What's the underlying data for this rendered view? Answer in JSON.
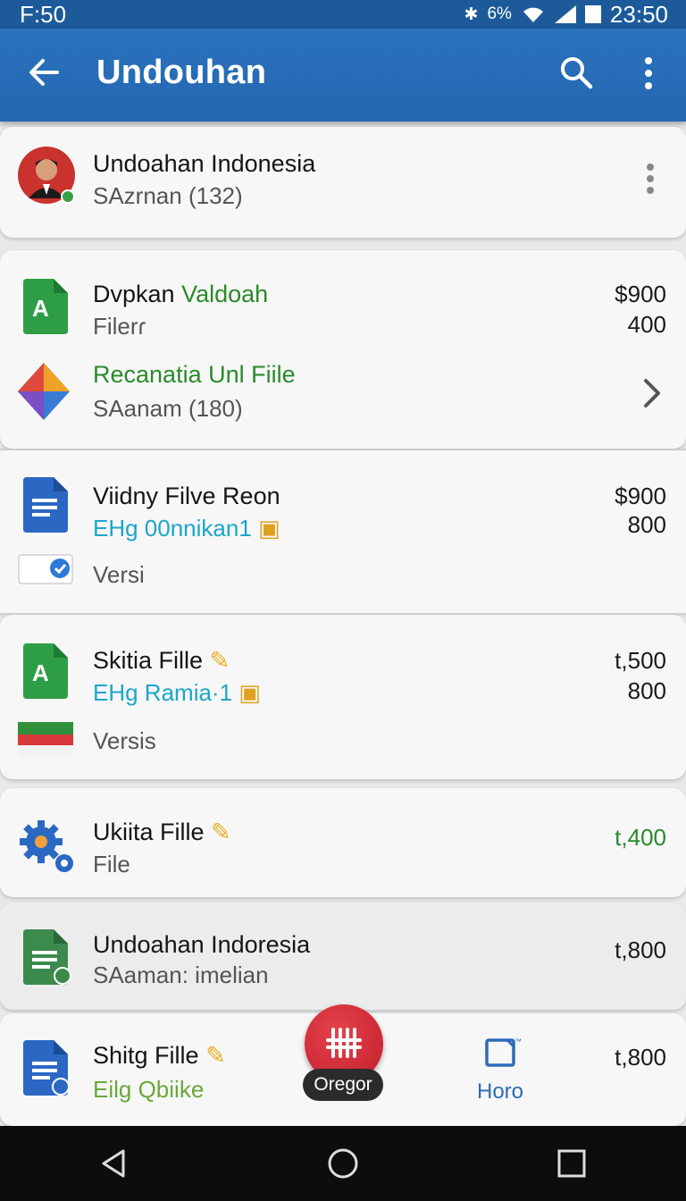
{
  "status_bar": {
    "left_text": "F:50",
    "battery_percent": "6%",
    "time": "23:50"
  },
  "app_bar": {
    "title": "Undouhan",
    "back_icon": "arrow-left-icon",
    "search_icon": "search-icon",
    "more_icon": "more-vertical-icon"
  },
  "header_card": {
    "title": "Undoahan Indonesia",
    "subtitle": "SAzrnan (132)"
  },
  "items": [
    {
      "title_part1": "Dvpkan",
      "title_part2": "Valdoah",
      "subtitle": "Filerɾ",
      "amount1": "$900",
      "amount2": "400",
      "icon": "spreadsheet-icon"
    },
    {
      "title": "Recanatia Unl Fiile",
      "subtitle": "SAanam (180)",
      "icon": "drive-icon",
      "chevron": "chevron-right-icon"
    },
    {
      "title": "Viidny Filve Reon",
      "subtitle": "EHg 00nnikan1",
      "extra": "Versi",
      "amount1": "$900",
      "amount2": "800",
      "icon": "document-icon"
    },
    {
      "title": "Skitia Fille",
      "subtitle": "EHg Ramia·1",
      "extra": "Versis",
      "amount1": "t,500",
      "amount2": "800",
      "icon": "spreadsheet-icon"
    },
    {
      "title": "Ukiita Fille",
      "subtitle": "File",
      "amount1": "t,400",
      "icon": "gear-icon"
    },
    {
      "title": "Undoahan Indoresia",
      "subtitle": "SAaman: imelian",
      "amount1": "t,800",
      "icon": "sheet-doc-icon"
    },
    {
      "title": "Shitg Fille",
      "subtitle": "Eilg Qbiike",
      "amount1": "t,800",
      "icon": "document-icon"
    }
  ],
  "fab": {
    "label": "Oregor"
  },
  "nav_item": {
    "label": "Horo",
    "tm": "™"
  },
  "colors": {
    "primary": "#2467b0",
    "green": "#2a8a2a",
    "fab": "#c11d2a"
  }
}
